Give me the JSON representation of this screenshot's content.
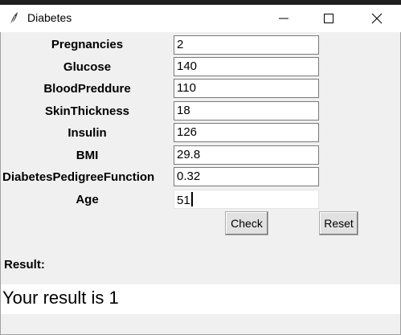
{
  "window": {
    "title": "Diabetes",
    "title_icon": "feather-icon",
    "controls": [
      "minimize-icon",
      "maximize-icon",
      "close-icon"
    ]
  },
  "form": {
    "fields": [
      {
        "label": "Pregnancies",
        "value": "2"
      },
      {
        "label": "Glucose",
        "value": "140"
      },
      {
        "label": "BloodPreddure",
        "value": "110"
      },
      {
        "label": "SkinThickness",
        "value": "18"
      },
      {
        "label": "Insulin",
        "value": "126"
      },
      {
        "label": "BMI",
        "value": "29.8"
      },
      {
        "label": "DiabetesPedigreeFunction",
        "value": "0.32"
      },
      {
        "label": "Age",
        "value": "51"
      }
    ]
  },
  "buttons": {
    "check": "Check",
    "reset": "Reset"
  },
  "result": {
    "label": "Result:",
    "text": "Your result is 1"
  },
  "colors": {
    "window_bg": "#f0f0f0",
    "titlebar_bg": "#ffffff",
    "entry_bg": "#ffffff",
    "button_bg": "#e1e1e1"
  }
}
